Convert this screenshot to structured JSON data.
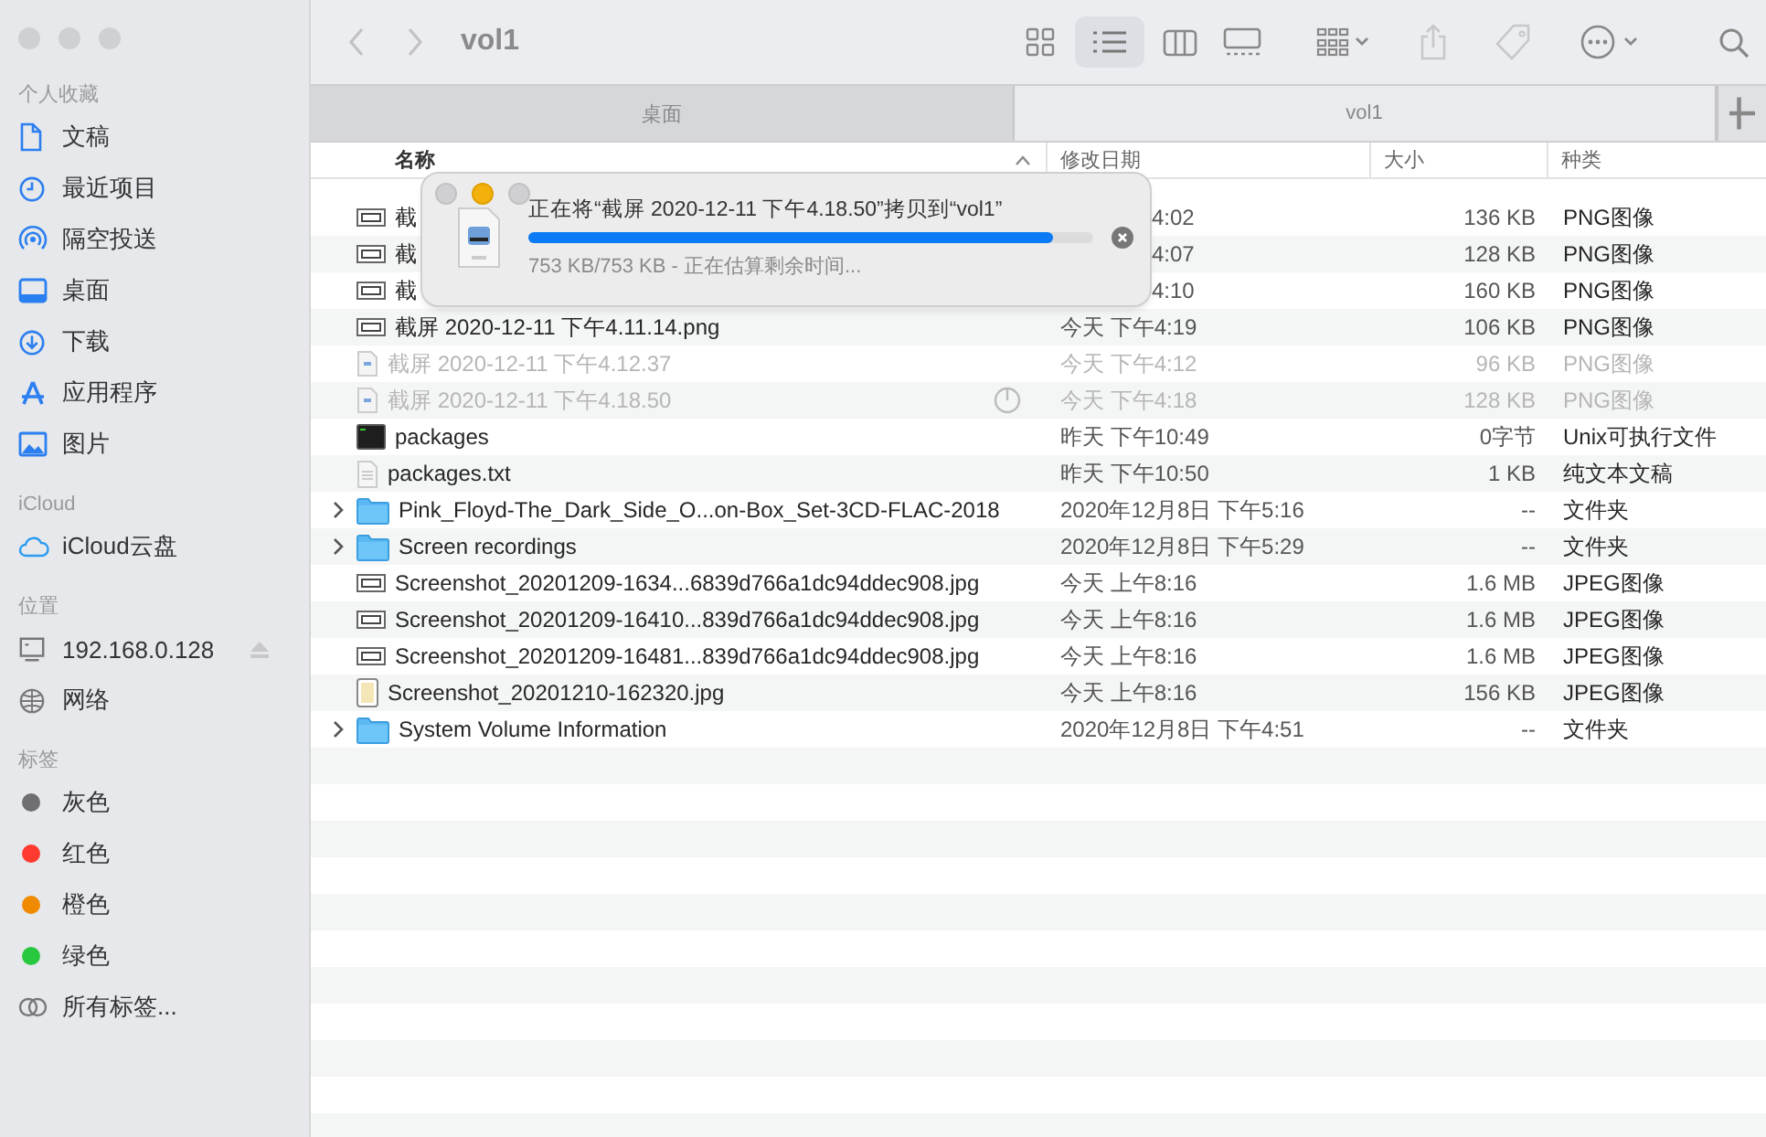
{
  "window": {
    "title": "vol1"
  },
  "sidebar": {
    "sections": [
      {
        "title": "个人收藏",
        "items": [
          {
            "label": "文稿",
            "kind": "document"
          },
          {
            "label": "最近项目",
            "kind": "clock"
          },
          {
            "label": "隔空投送",
            "kind": "airdrop"
          },
          {
            "label": "桌面",
            "kind": "desktop"
          },
          {
            "label": "下载",
            "kind": "download"
          },
          {
            "label": "应用程序",
            "kind": "apps"
          },
          {
            "label": "图片",
            "kind": "photo"
          }
        ]
      },
      {
        "title": "iCloud",
        "items": [
          {
            "label": "iCloud云盘",
            "kind": "cloud"
          }
        ]
      },
      {
        "title": "位置",
        "items": [
          {
            "label": "192.168.0.128",
            "kind": "computer",
            "ejectable": true
          },
          {
            "label": "网络",
            "kind": "globe",
            "ejectable": false
          }
        ]
      },
      {
        "title": "标签",
        "items": [
          {
            "label": "灰色",
            "kind": "tag",
            "color": "#6e6e73"
          },
          {
            "label": "红色",
            "kind": "tag",
            "color": "#ff3b30"
          },
          {
            "label": "橙色",
            "kind": "tag",
            "color": "#f08a00"
          },
          {
            "label": "绿色",
            "kind": "tag",
            "color": "#28c840"
          },
          {
            "label": "所有标签...",
            "kind": "alltags"
          }
        ]
      }
    ]
  },
  "toolbar": {
    "views": [
      {
        "kind": "icons",
        "selected": false
      },
      {
        "kind": "list",
        "selected": true
      },
      {
        "kind": "columns",
        "selected": false
      },
      {
        "kind": "gallery",
        "selected": false
      }
    ]
  },
  "tabs": [
    {
      "label": "桌面",
      "selected": false
    },
    {
      "label": "vol1",
      "selected": true
    }
  ],
  "table": {
    "columns": [
      {
        "label": "名称",
        "sorted": true
      },
      {
        "label": "修改日期",
        "sorted": false
      },
      {
        "label": "大小",
        "sorted": false
      },
      {
        "label": "种类",
        "sorted": false
      }
    ],
    "rows": [
      {
        "kind": "image",
        "name": "截",
        "date": "4:02",
        "size": "136 KB",
        "type": "PNG图像",
        "dimmed": false,
        "expandable": false,
        "busy": false
      },
      {
        "kind": "image",
        "name": "截",
        "date": "4:07",
        "size": "128 KB",
        "type": "PNG图像",
        "dimmed": false,
        "expandable": false,
        "busy": false
      },
      {
        "kind": "image",
        "name": "截",
        "date": "4:10",
        "size": "160 KB",
        "type": "PNG图像",
        "dimmed": false,
        "expandable": false,
        "busy": false
      },
      {
        "kind": "image",
        "name": "截屏 2020-12-11 下午4.11.14.png",
        "date": "今天 下午4:19",
        "size": "106 KB",
        "type": "PNG图像",
        "dimmed": false,
        "expandable": false,
        "busy": false
      },
      {
        "kind": "pngdoc",
        "name": "截屏 2020-12-11 下午4.12.37",
        "date": "今天 下午4:12",
        "size": "96 KB",
        "type": "PNG图像",
        "dimmed": true,
        "expandable": false,
        "busy": false
      },
      {
        "kind": "pngdoc",
        "name": "截屏 2020-12-11 下午4.18.50",
        "date": "今天 下午4:18",
        "size": "128 KB",
        "type": "PNG图像",
        "dimmed": true,
        "expandable": false,
        "busy": true
      },
      {
        "kind": "terminal",
        "name": "packages",
        "date": "昨天 下午10:49",
        "size": "0字节",
        "type": "Unix可执行文件",
        "dimmed": false,
        "expandable": false,
        "busy": false
      },
      {
        "kind": "text",
        "name": "packages.txt",
        "date": "昨天 下午10:50",
        "size": "1 KB",
        "type": "纯文本文稿",
        "dimmed": false,
        "expandable": false,
        "busy": false
      },
      {
        "kind": "folder",
        "name": "Pink_Floyd-The_Dark_Side_O...on-Box_Set-3CD-FLAC-2018",
        "date": "2020年12月8日 下午5:16",
        "size": "--",
        "type": "文件夹",
        "dimmed": false,
        "expandable": true,
        "busy": false
      },
      {
        "kind": "folder",
        "name": "Screen recordings",
        "date": "2020年12月8日 下午5:29",
        "size": "--",
        "type": "文件夹",
        "dimmed": false,
        "expandable": true,
        "busy": false
      },
      {
        "kind": "image",
        "name": "Screenshot_20201209-1634...6839d766a1dc94ddec908.jpg",
        "date": "今天 上午8:16",
        "size": "1.6 MB",
        "type": "JPEG图像",
        "dimmed": false,
        "expandable": false,
        "busy": false
      },
      {
        "kind": "image",
        "name": "Screenshot_20201209-16410...839d766a1dc94ddec908.jpg",
        "date": "今天 上午8:16",
        "size": "1.6 MB",
        "type": "JPEG图像",
        "dimmed": false,
        "expandable": false,
        "busy": false
      },
      {
        "kind": "image",
        "name": "Screenshot_20201209-16481...839d766a1dc94ddec908.jpg",
        "date": "今天 上午8:16",
        "size": "1.6 MB",
        "type": "JPEG图像",
        "dimmed": false,
        "expandable": false,
        "busy": false
      },
      {
        "kind": "phone",
        "name": "Screenshot_20201210-162320.jpg",
        "date": "今天 上午8:16",
        "size": "156 KB",
        "type": "JPEG图像",
        "dimmed": false,
        "expandable": false,
        "busy": false
      },
      {
        "kind": "folder",
        "name": "System Volume Information",
        "date": "2020年12月8日 下午4:51",
        "size": "--",
        "type": "文件夹",
        "dimmed": false,
        "expandable": true,
        "busy": false
      }
    ]
  },
  "copy_dialog": {
    "message": "正在将“截屏 2020-12-11 下午4.18.50”拷贝到“vol1”",
    "level": 0.93,
    "status": "753 KB/753 KB - 正在估算剩余时间..."
  }
}
